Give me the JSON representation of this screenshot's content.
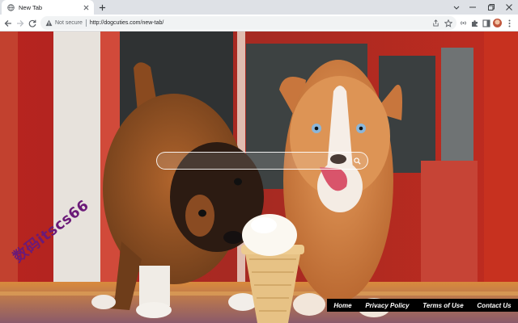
{
  "browser": {
    "tab": {
      "title": "New Tab"
    },
    "address_bar": {
      "security_label": "Not secure",
      "url": "http://dogcuties.com/new-tab/"
    }
  },
  "page": {
    "search": {
      "placeholder": "",
      "value": ""
    },
    "footer_links": {
      "home": "Home",
      "privacy": "Privacy Policy",
      "terms": "Terms of Use",
      "contact": "Contact Us"
    },
    "watermark": "数码itscs66"
  },
  "colors": {
    "tabstrip": "#dee1e6",
    "omnibox": "#f1f3f4",
    "footer_bg": "#000000",
    "watermark": "#6b1a78"
  },
  "icons": {
    "favicon": "globe-icon",
    "security": "warning-icon",
    "search": "search-icon"
  }
}
